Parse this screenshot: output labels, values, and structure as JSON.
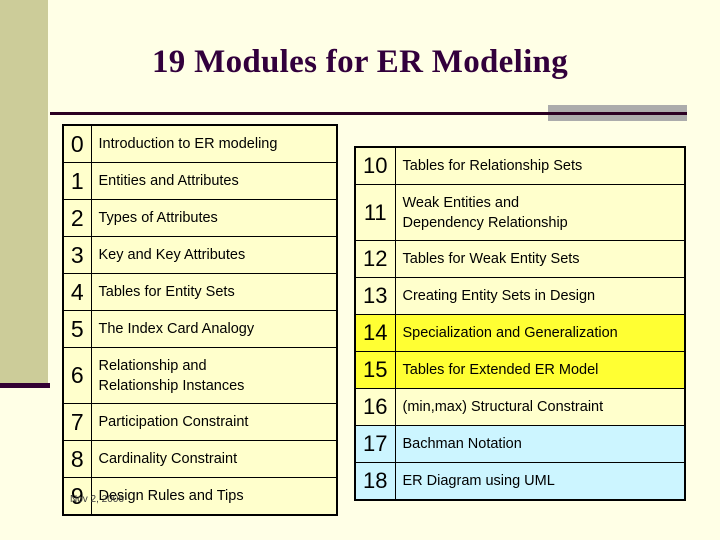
{
  "slide": {
    "title": "19 Modules for ER Modeling",
    "date_stamp": "Nov 2, 2006",
    "colors": {
      "background": "#FFFFE6",
      "side_strip": "#CCCC99",
      "rule": "#330033",
      "accent_bar": "#ACACAC",
      "title_text": "#32003C",
      "cell_default": "#FFFFCC",
      "highlight_yellow": "#FFFF33",
      "highlight_cyan": "#CCF5FF"
    }
  },
  "table_left": {
    "rows": [
      {
        "num": "0",
        "text": "Introduction to ER modeling",
        "lines": 1,
        "fill": "default"
      },
      {
        "num": "1",
        "text": "Entities and Attributes",
        "lines": 1,
        "fill": "default"
      },
      {
        "num": "2",
        "text": "Types of Attributes",
        "lines": 1,
        "fill": "default"
      },
      {
        "num": "3",
        "text": "Key and Key Attributes",
        "lines": 1,
        "fill": "default"
      },
      {
        "num": "4",
        "text": "Tables for Entity Sets",
        "lines": 1,
        "fill": "default"
      },
      {
        "num": "5",
        "text": "The Index Card Analogy",
        "lines": 1,
        "fill": "default"
      },
      {
        "num": "6",
        "text": "Relationship and Relationship Instances",
        "line1": "Relationship and",
        "line2": "Relationship Instances",
        "lines": 2,
        "fill": "default"
      },
      {
        "num": "7",
        "text": "Participation Constraint",
        "lines": 1,
        "fill": "default"
      },
      {
        "num": "8",
        "text": "Cardinality Constraint",
        "lines": 1,
        "fill": "default"
      },
      {
        "num": "9",
        "text": "Design Rules and Tips",
        "lines": 1,
        "fill": "default"
      }
    ]
  },
  "table_right": {
    "rows": [
      {
        "num": "10",
        "text": "Tables for Relationship Sets",
        "lines": 1,
        "fill": "default"
      },
      {
        "num": "11",
        "text": "Weak Entities and Dependency Relationship",
        "line1": "Weak Entities and",
        "line2": "Dependency Relationship",
        "lines": 2,
        "fill": "default"
      },
      {
        "num": "12",
        "text": "Tables for Weak Entity Sets",
        "lines": 1,
        "fill": "default"
      },
      {
        "num": "13",
        "text": "Creating Entity Sets in Design",
        "lines": 1,
        "fill": "default"
      },
      {
        "num": "14",
        "text": "Specialization and Generalization",
        "lines": 1,
        "fill": "yellow"
      },
      {
        "num": "15",
        "text": "Tables for Extended ER Model",
        "lines": 1,
        "fill": "yellow"
      },
      {
        "num": "16",
        "text": "(min,max) Structural Constraint",
        "lines": 1,
        "fill": "default"
      },
      {
        "num": "17",
        "text": "Bachman Notation",
        "lines": 1,
        "fill": "cyan"
      },
      {
        "num": "18",
        "text": "ER Diagram using UML",
        "lines": 1,
        "fill": "cyan"
      }
    ]
  }
}
